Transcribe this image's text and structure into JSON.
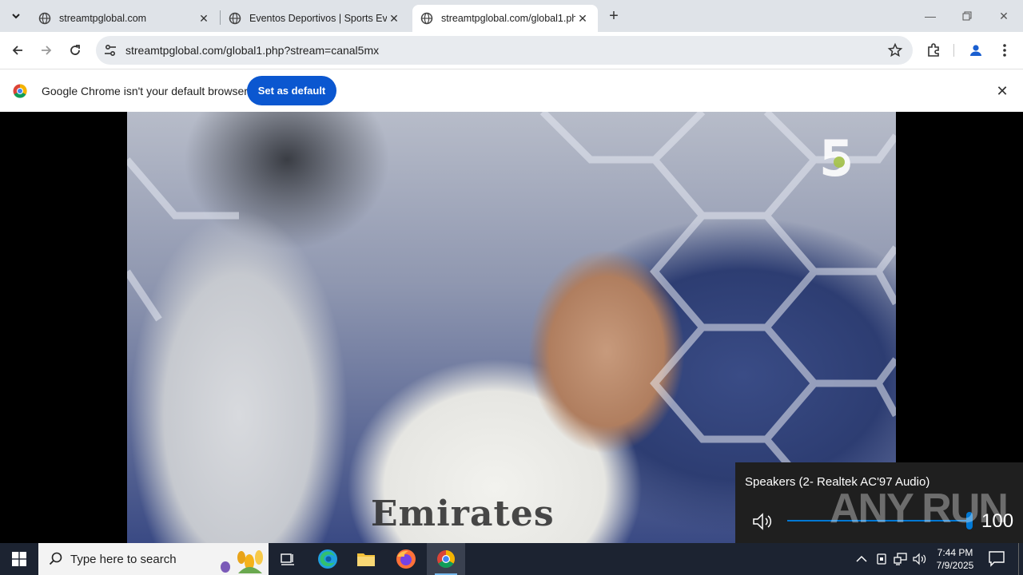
{
  "browser": {
    "tabs": [
      {
        "title": "streamtpglobal.com",
        "active": false
      },
      {
        "title": "Eventos Deportivos | Sports Eve",
        "active": false
      },
      {
        "title": "streamtpglobal.com/global1.ph",
        "active": true
      }
    ],
    "url": "streamtpglobal.com/global1.php?stream=canal5mx",
    "infobar": {
      "message": "Google Chrome isn't your default browser",
      "button": "Set as default"
    }
  },
  "video": {
    "channel_logo": "5",
    "sponsor_text": "Emirates"
  },
  "volume_popup": {
    "device": "Speakers (2- Realtek AC'97 Audio)",
    "level": "100"
  },
  "watermark": "ANY RUN",
  "taskbar": {
    "search_placeholder": "Type here to search",
    "time": "7:44 PM",
    "date": "7/9/2025"
  }
}
